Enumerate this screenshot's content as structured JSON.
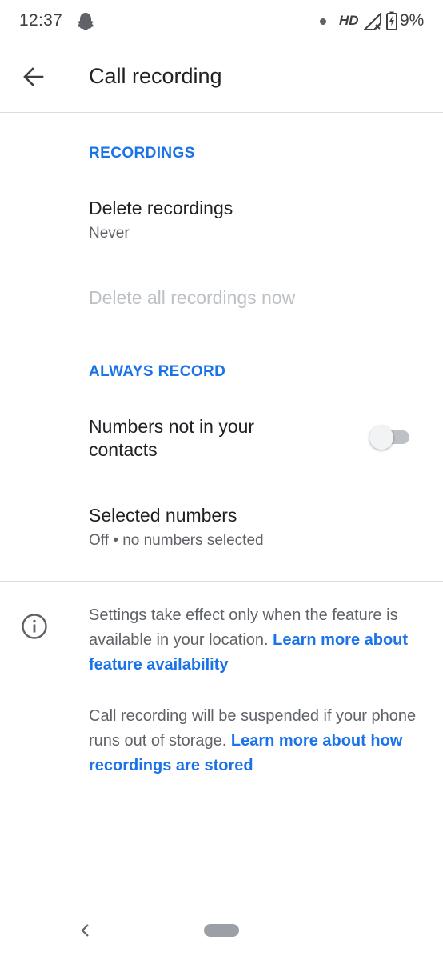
{
  "status_bar": {
    "time": "12:37",
    "network_label": "HD",
    "battery_level": "9%",
    "icons": [
      "snapchat-ghost-icon",
      "notification-dot-icon",
      "signal-no-data-icon",
      "battery-charging-icon"
    ]
  },
  "app_bar": {
    "title": "Call recording",
    "back_icon": "arrow-left-icon"
  },
  "recordings_section": {
    "header": "RECORDINGS",
    "delete_recordings": {
      "title": "Delete recordings",
      "value": "Never"
    },
    "delete_all": {
      "label": "Delete all recordings now",
      "enabled": false
    }
  },
  "always_record_section": {
    "header": "ALWAYS RECORD",
    "numbers_not_in_contacts": {
      "title": "Numbers not in your contacts",
      "toggle_on": false
    },
    "selected_numbers": {
      "title": "Selected numbers",
      "summary": "Off • no numbers selected"
    }
  },
  "info": {
    "icon": "info-icon",
    "para1_text": "Settings take effect only when the feature is available in your location. ",
    "para1_link": "Learn more about feature availability",
    "para2_text": "Call recording will be suspended if your phone runs out of storage. ",
    "para2_link": "Learn more about how recordings are stored"
  },
  "colors": {
    "accent": "#1a73e8",
    "primary_text": "#202124",
    "secondary_text": "#5f6368",
    "disabled_text": "#bdc1c6"
  },
  "nav_bar": {
    "back_icon": "chevron-left-icon",
    "home_icon": "home-pill-icon"
  }
}
